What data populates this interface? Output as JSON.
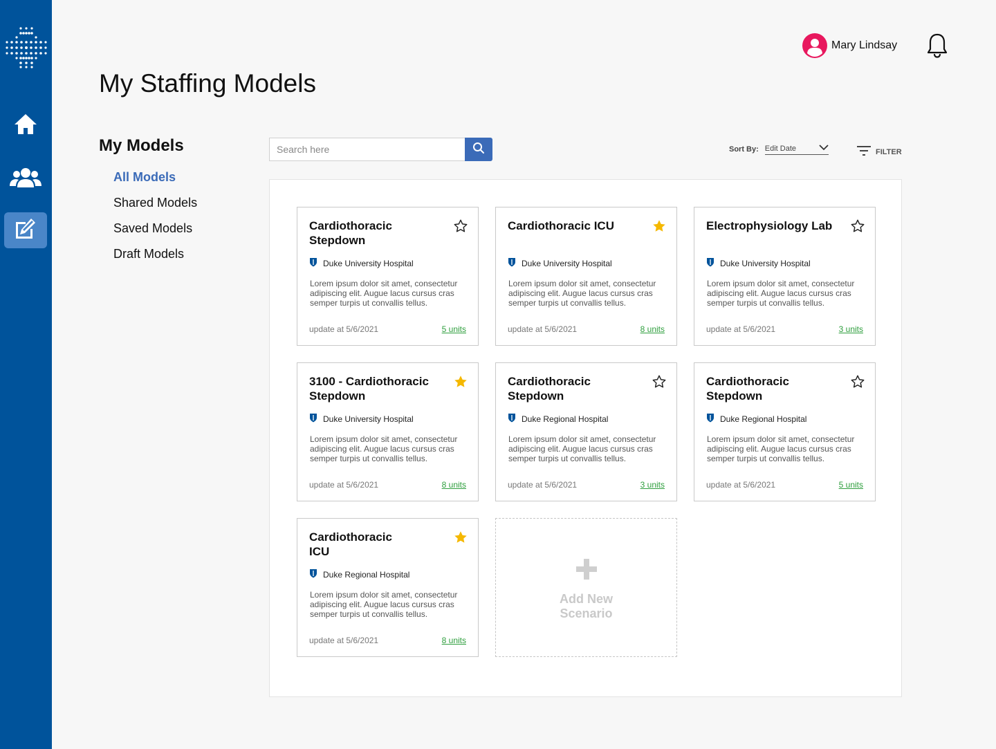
{
  "header": {
    "page_title": "My Staffing Models",
    "user_name": "Mary Lindsay"
  },
  "sidebar": {
    "items": [
      {
        "name": "home",
        "icon": "home-icon"
      },
      {
        "name": "team",
        "icon": "users-icon"
      },
      {
        "name": "models",
        "icon": "edit-icon",
        "active": true
      }
    ]
  },
  "models_nav": {
    "title": "My Models",
    "items": [
      "All Models",
      "Shared Models",
      "Saved Models",
      "Draft Models"
    ],
    "active": "All Models"
  },
  "toolbar": {
    "search_placeholder": "Search here",
    "sort_label": "Sort By:",
    "sort_value": "Edit Date",
    "filter_label": "FILTER"
  },
  "cards": [
    {
      "title": "Cardiothoracic Stepdown",
      "starred": false,
      "hospital": "Duke University Hospital",
      "description": "Lorem ipsum dolor sit amet, consectetur adipiscing elit. Augue lacus cursus cras semper turpis ut convallis tellus.",
      "updated": "update at 5/6/2021",
      "units": "5 units"
    },
    {
      "title": "Cardiothoracic ICU",
      "starred": true,
      "hospital": "Duke University Hospital",
      "description": "Lorem ipsum dolor sit amet, consectetur adipiscing elit. Augue lacus cursus cras semper turpis ut convallis tellus.",
      "updated": "update at 5/6/2021",
      "units": "8 units"
    },
    {
      "title": "Electrophysiology Lab",
      "starred": false,
      "hospital": "Duke University Hospital",
      "description": "Lorem ipsum dolor sit amet, consectetur adipiscing elit. Augue lacus cursus cras semper turpis ut convallis tellus.",
      "updated": "update at 5/6/2021",
      "units": "3 units"
    },
    {
      "title": "3100 - Cardiothoracic Stepdown",
      "starred": true,
      "hospital": "Duke University Hospital",
      "description": "Lorem ipsum dolor sit amet, consectetur adipiscing elit. Augue lacus cursus cras semper turpis ut convallis tellus.",
      "updated": "update at 5/6/2021",
      "units": "8 units"
    },
    {
      "title": "Cardiothoracic Stepdown",
      "starred": false,
      "hospital": "Duke Regional Hospital",
      "description": "Lorem ipsum dolor sit amet, consectetur adipiscing elit. Augue lacus cursus cras semper turpis ut convallis tellus.",
      "updated": "update at 5/6/2021",
      "units": "3 units"
    },
    {
      "title": "Cardiothoracic Stepdown",
      "starred": false,
      "hospital": "Duke Regional Hospital",
      "description": "Lorem ipsum dolor sit amet, consectetur adipiscing elit. Augue lacus cursus cras semper turpis ut convallis tellus.",
      "updated": "update at 5/6/2021",
      "units": "5 units"
    },
    {
      "title": "Cardiothoracic ICU",
      "starred": true,
      "hospital": "Duke Regional Hospital",
      "description": "Lorem ipsum dolor sit amet, consectetur adipiscing elit. Augue lacus cursus cras semper turpis ut convallis tellus.",
      "updated": "update at 5/6/2021",
      "units": "8 units"
    }
  ],
  "add_card": {
    "label": "Add New Scenario"
  },
  "colors": {
    "sidebar": "#00539b",
    "accent": "#3b6bb8",
    "star": "#f5b800",
    "units": "#2e9e3d",
    "avatar": "#e8185e"
  }
}
